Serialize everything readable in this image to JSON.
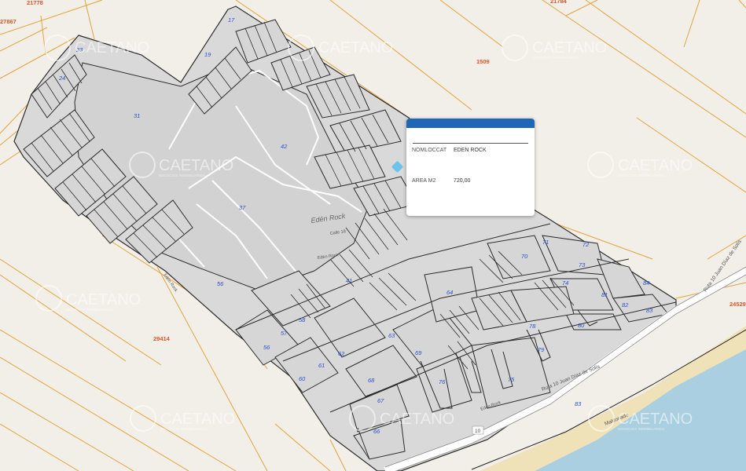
{
  "map": {
    "place_label": "Edén Rock",
    "street_labels": [
      "Calle 18",
      "Edén Rock",
      "Edén Rock",
      "Edén Rock"
    ],
    "road_labels": [
      "Ruta 10 Juan Díaz de Solís",
      "Ruta 10 Juan Díaz de Solís",
      "Maldonado"
    ],
    "route_shield": "10",
    "parcel_numbers": [
      "21778",
      "27867",
      "1509",
      "29414",
      "24529",
      "21784"
    ],
    "block_numbers": [
      "17",
      "23",
      "19",
      "24",
      "31",
      "42",
      "37",
      "56",
      "41",
      "58",
      "57",
      "56",
      "62",
      "61",
      "60",
      "63",
      "64",
      "69",
      "68",
      "67",
      "66",
      "76",
      "75",
      "70",
      "71",
      "72",
      "73",
      "74",
      "81",
      "82",
      "83",
      "84",
      "78",
      "80",
      "79",
      "83"
    ],
    "colors": {
      "background": "#f2efe9",
      "block_fill": "#d8d8d8",
      "block_stroke": "#2b2b2b",
      "parcel_line": "#e3a33c",
      "sea": "#a9cfe0",
      "beach": "#f0e4bf",
      "popup_header": "#1f67b4"
    }
  },
  "watermark": {
    "brand": "CAETANO",
    "tagline": "NEGOCIOS INMOBILIARIOS"
  },
  "popup": {
    "fields": [
      {
        "key": "NOMLOCCAT",
        "value": "EDEN ROCK"
      },
      {
        "key": "AREA M2",
        "value": "720,00"
      }
    ]
  }
}
